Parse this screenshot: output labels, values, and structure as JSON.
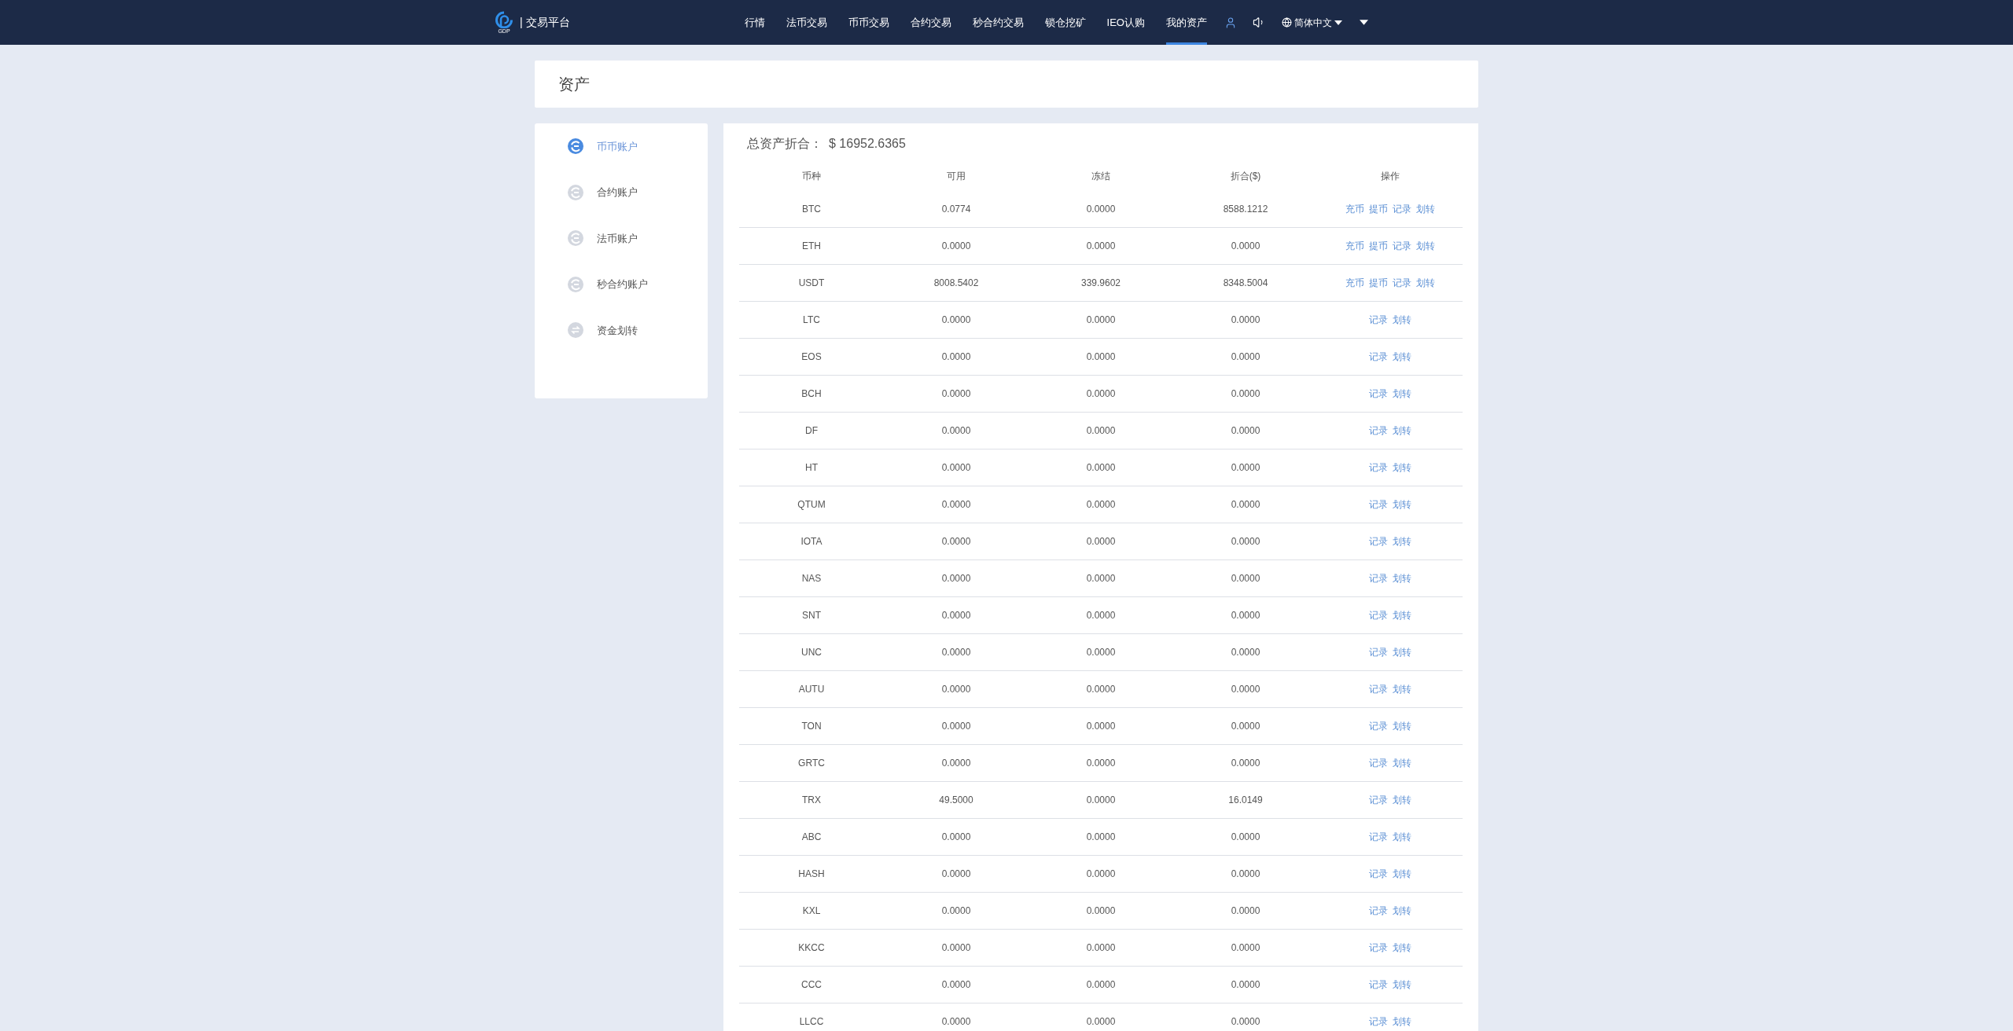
{
  "header": {
    "logo_text": "GDP",
    "brand": "| 交易平台",
    "nav": [
      {
        "label": "行情",
        "selected": false
      },
      {
        "label": "法币交易",
        "selected": false
      },
      {
        "label": "币币交易",
        "selected": false
      },
      {
        "label": "合约交易",
        "selected": false
      },
      {
        "label": "秒合约交易",
        "selected": false
      },
      {
        "label": "锁仓挖矿",
        "selected": false
      },
      {
        "label": "IEO认购",
        "selected": false
      },
      {
        "label": "我的资产",
        "selected": true
      }
    ],
    "language": "简体中文"
  },
  "page_title": "资产",
  "sidebar": {
    "items": [
      {
        "label": "币币账户",
        "selected": true,
        "kind": "account"
      },
      {
        "label": "合约账户",
        "selected": false,
        "kind": "account"
      },
      {
        "label": "法币账户",
        "selected": false,
        "kind": "account"
      },
      {
        "label": "秒合约账户",
        "selected": false,
        "kind": "account"
      },
      {
        "label": "资金划转",
        "selected": false,
        "kind": "transfer"
      }
    ]
  },
  "summary": {
    "label": "总资产折合：",
    "value": "$ 16952.6365"
  },
  "table": {
    "columns": [
      "币种",
      "可用",
      "冻结",
      "折合($)",
      "操作"
    ],
    "rows": [
      {
        "coin": "BTC",
        "available": "0.0774",
        "frozen": "0.0000",
        "converted": "8588.1212",
        "actions": [
          "充币",
          "提币",
          "记录",
          "划转"
        ]
      },
      {
        "coin": "ETH",
        "available": "0.0000",
        "frozen": "0.0000",
        "converted": "0.0000",
        "actions": [
          "充币",
          "提币",
          "记录",
          "划转"
        ]
      },
      {
        "coin": "USDT",
        "available": "8008.5402",
        "frozen": "339.9602",
        "converted": "8348.5004",
        "actions": [
          "充币",
          "提币",
          "记录",
          "划转"
        ]
      },
      {
        "coin": "LTC",
        "available": "0.0000",
        "frozen": "0.0000",
        "converted": "0.0000",
        "actions": [
          "记录",
          "划转"
        ]
      },
      {
        "coin": "EOS",
        "available": "0.0000",
        "frozen": "0.0000",
        "converted": "0.0000",
        "actions": [
          "记录",
          "划转"
        ]
      },
      {
        "coin": "BCH",
        "available": "0.0000",
        "frozen": "0.0000",
        "converted": "0.0000",
        "actions": [
          "记录",
          "划转"
        ]
      },
      {
        "coin": "DF",
        "available": "0.0000",
        "frozen": "0.0000",
        "converted": "0.0000",
        "actions": [
          "记录",
          "划转"
        ]
      },
      {
        "coin": "HT",
        "available": "0.0000",
        "frozen": "0.0000",
        "converted": "0.0000",
        "actions": [
          "记录",
          "划转"
        ]
      },
      {
        "coin": "QTUM",
        "available": "0.0000",
        "frozen": "0.0000",
        "converted": "0.0000",
        "actions": [
          "记录",
          "划转"
        ]
      },
      {
        "coin": "IOTA",
        "available": "0.0000",
        "frozen": "0.0000",
        "converted": "0.0000",
        "actions": [
          "记录",
          "划转"
        ]
      },
      {
        "coin": "NAS",
        "available": "0.0000",
        "frozen": "0.0000",
        "converted": "0.0000",
        "actions": [
          "记录",
          "划转"
        ]
      },
      {
        "coin": "SNT",
        "available": "0.0000",
        "frozen": "0.0000",
        "converted": "0.0000",
        "actions": [
          "记录",
          "划转"
        ]
      },
      {
        "coin": "UNC",
        "available": "0.0000",
        "frozen": "0.0000",
        "converted": "0.0000",
        "actions": [
          "记录",
          "划转"
        ]
      },
      {
        "coin": "AUTU",
        "available": "0.0000",
        "frozen": "0.0000",
        "converted": "0.0000",
        "actions": [
          "记录",
          "划转"
        ]
      },
      {
        "coin": "TON",
        "available": "0.0000",
        "frozen": "0.0000",
        "converted": "0.0000",
        "actions": [
          "记录",
          "划转"
        ]
      },
      {
        "coin": "GRTC",
        "available": "0.0000",
        "frozen": "0.0000",
        "converted": "0.0000",
        "actions": [
          "记录",
          "划转"
        ]
      },
      {
        "coin": "TRX",
        "available": "49.5000",
        "frozen": "0.0000",
        "converted": "16.0149",
        "actions": [
          "记录",
          "划转"
        ]
      },
      {
        "coin": "ABC",
        "available": "0.0000",
        "frozen": "0.0000",
        "converted": "0.0000",
        "actions": [
          "记录",
          "划转"
        ]
      },
      {
        "coin": "HASH",
        "available": "0.0000",
        "frozen": "0.0000",
        "converted": "0.0000",
        "actions": [
          "记录",
          "划转"
        ]
      },
      {
        "coin": "KXL",
        "available": "0.0000",
        "frozen": "0.0000",
        "converted": "0.0000",
        "actions": [
          "记录",
          "划转"
        ]
      },
      {
        "coin": "KKCC",
        "available": "0.0000",
        "frozen": "0.0000",
        "converted": "0.0000",
        "actions": [
          "记录",
          "划转"
        ]
      },
      {
        "coin": "CCC",
        "available": "0.0000",
        "frozen": "0.0000",
        "converted": "0.0000",
        "actions": [
          "记录",
          "划转"
        ]
      },
      {
        "coin": "LLCC",
        "available": "0.0000",
        "frozen": "0.0000",
        "converted": "0.0000",
        "actions": [
          "记录",
          "划转"
        ]
      }
    ]
  }
}
